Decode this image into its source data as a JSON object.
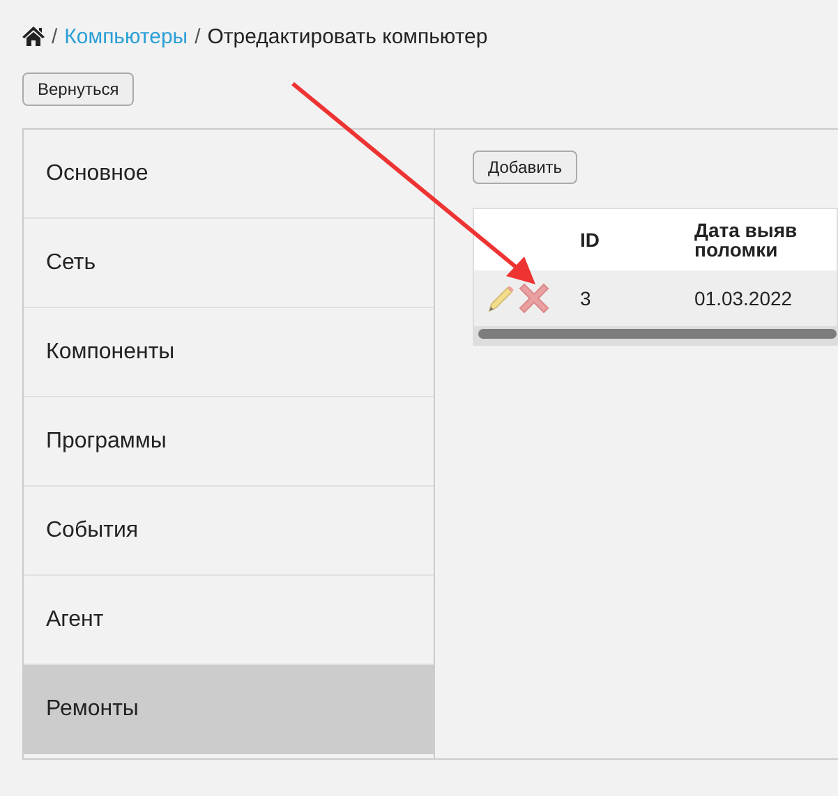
{
  "breadcrumb": {
    "items": [
      {
        "label": "Компьютеры",
        "kind": "link"
      },
      {
        "label": "Отредактировать компьютер",
        "kind": "current"
      }
    ],
    "separator": "/"
  },
  "back_button": "Вернуться",
  "sidebar": {
    "items": [
      {
        "label": "Основное",
        "selected": false
      },
      {
        "label": "Сеть",
        "selected": false
      },
      {
        "label": "Компоненты",
        "selected": false
      },
      {
        "label": "Программы",
        "selected": false
      },
      {
        "label": "События",
        "selected": false
      },
      {
        "label": "Агент",
        "selected": false
      },
      {
        "label": "Ремонты",
        "selected": true
      }
    ]
  },
  "add_button": "Добавить",
  "table": {
    "columns": [
      "ID",
      "Дата выяв\nполомки"
    ],
    "rows": [
      {
        "cells": [
          "3",
          "01.03.2022"
        ]
      }
    ]
  }
}
